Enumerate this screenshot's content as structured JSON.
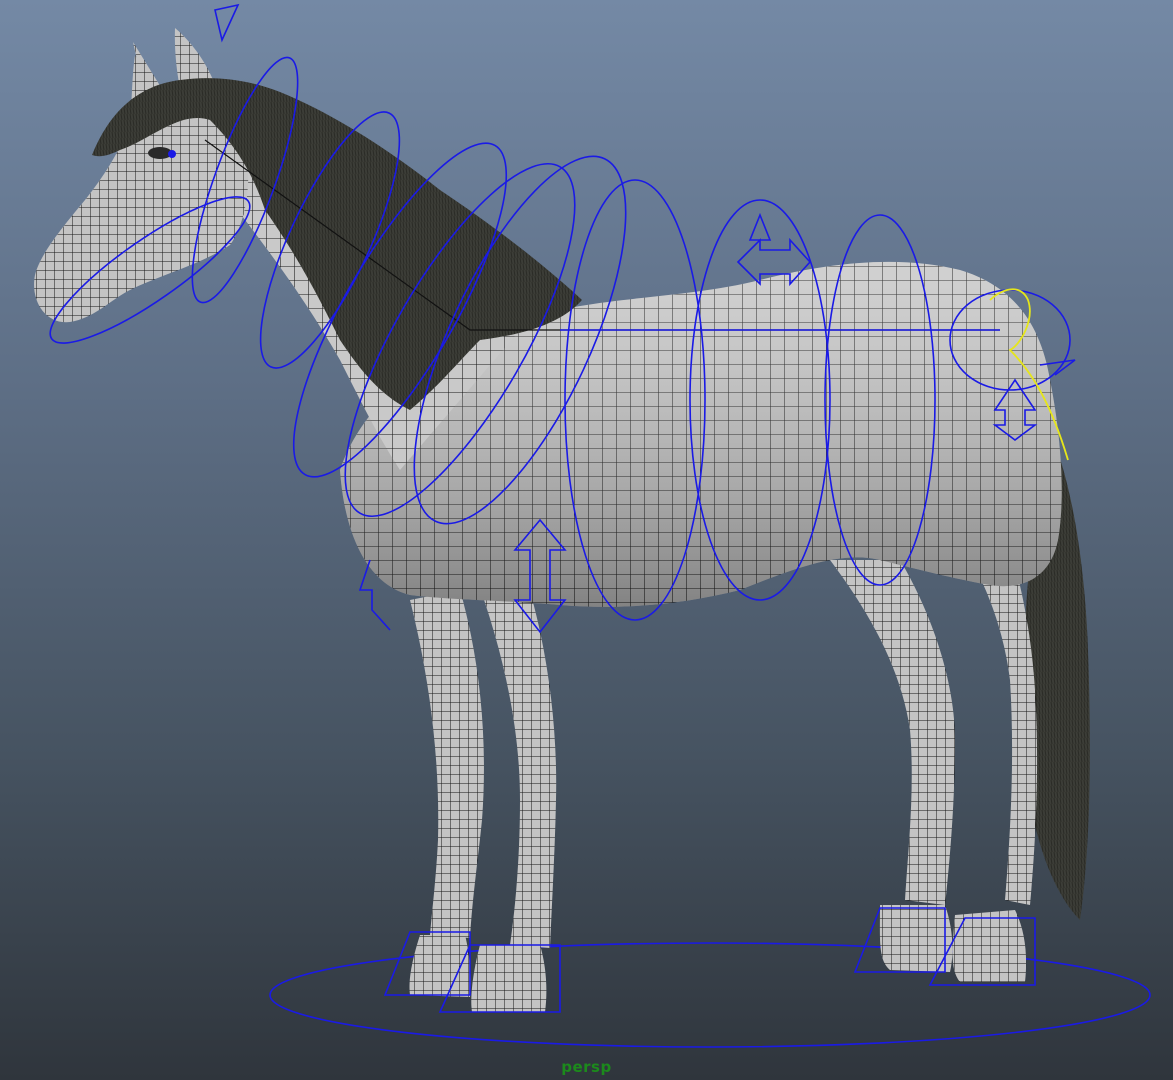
{
  "viewport": {
    "camera_label": "persp"
  },
  "scene": {
    "object": "horse-rig",
    "colors": {
      "background_top": "#7489a5",
      "background_bottom": "#2f353c",
      "mesh_fill": "#bfbfbf",
      "mesh_wire": "#1a1a1a",
      "mane_tail": "#3b3b36",
      "controls": "#1a1ae6",
      "selected_control": "#e6e61a",
      "camera_label": "#1c8a1c"
    }
  }
}
